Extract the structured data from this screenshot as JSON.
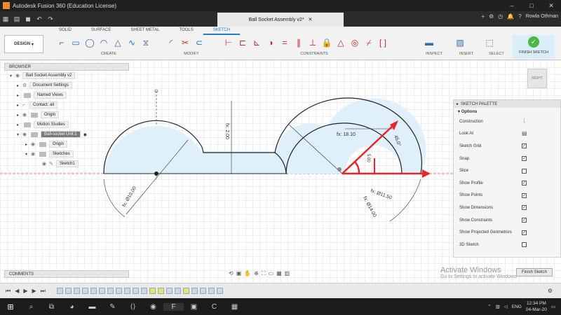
{
  "window": {
    "title": "Autodesk Fusion 360 (Education License)"
  },
  "tabbar": {
    "doc_tab": "Ball Socket Assembly v2*",
    "user": "Rowla Othman"
  },
  "toolbar": {
    "workspace_button": "DESIGN",
    "tabs": [
      "SOLID",
      "SURFACE",
      "SHEET METAL",
      "TOOLS",
      "SKETCH"
    ],
    "groups": {
      "create": "CREATE",
      "modify": "MODIFY",
      "constraints": "CONSTRAINTS",
      "inspect": "INSPECT",
      "insert": "INSERT",
      "select": "SELECT",
      "finish": "FINISH SKETCH"
    }
  },
  "browser": {
    "header": "BROWSER",
    "items": [
      {
        "label": "Ball Socket Assembly v2"
      },
      {
        "label": "Document Settings"
      },
      {
        "label": "Named Views"
      },
      {
        "label": "Contact: all"
      },
      {
        "label": "Origin"
      },
      {
        "label": "Motion Studies"
      },
      {
        "label": "Ball-socket Unit:1"
      },
      {
        "label": "Origin"
      },
      {
        "label": "Sketches"
      },
      {
        "label": "Sketch1"
      }
    ]
  },
  "dimensions": {
    "d_top": "fx: 2.00",
    "d_left": "fx: Ø10.00",
    "d_mid": "fx: 18.10",
    "d_r1": "fx: Ø11.50",
    "d_r2": "fx: Ø14.00",
    "d_ang": "45.0°",
    "d_small": "5.00"
  },
  "view_cube": {
    "label": "RIGHT"
  },
  "palette": {
    "header": "SKETCH PALETTE",
    "section": "Options",
    "rows": [
      {
        "label": "Construction",
        "checked": null
      },
      {
        "label": "Look At",
        "checked": null
      },
      {
        "label": "Sketch Grid",
        "checked": true
      },
      {
        "label": "Snap",
        "checked": true
      },
      {
        "label": "Slice",
        "checked": false
      },
      {
        "label": "Show Profile",
        "checked": true
      },
      {
        "label": "Show Points",
        "checked": true
      },
      {
        "label": "Show Dimensions",
        "checked": true
      },
      {
        "label": "Show Constraints",
        "checked": true
      },
      {
        "label": "Show Projected Geometries",
        "checked": true
      },
      {
        "label": "3D Sketch",
        "checked": false
      }
    ],
    "finish_button": "Finish Sketch"
  },
  "watermark": {
    "line1": "Activate Windows",
    "line2": "Go to Settings to activate Windows."
  },
  "comments": {
    "label": "COMMENTS"
  },
  "taskbar": {
    "time": "12:34 PM",
    "date": "04-Mar-20",
    "lang": "ENG"
  },
  "colors": {
    "accent": "#1f7fc4",
    "arrow": "#e8262a",
    "profile": "#dff0fb"
  }
}
